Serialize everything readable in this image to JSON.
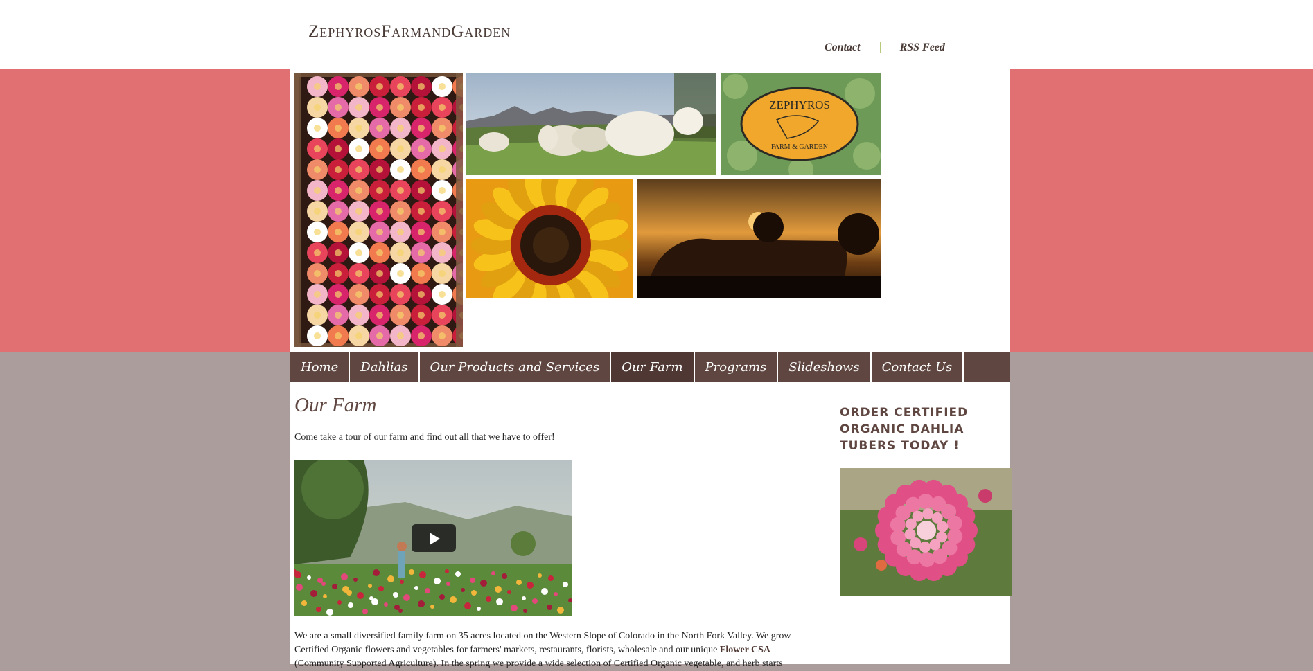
{
  "site": {
    "title": "ZephyrosFarmandGarden"
  },
  "top_links": [
    {
      "label": "Contact"
    },
    {
      "label": "RSS Feed"
    }
  ],
  "banner": {
    "logo_text": {
      "line1": "ZEPHYROS",
      "line2": "FARM & GARDEN"
    },
    "photos": [
      "dahlia-crate",
      "sheep-mountains",
      "zephyros-logo",
      "sunflower",
      "greenhouse-sunset"
    ]
  },
  "nav": {
    "items": [
      {
        "label": "Home"
      },
      {
        "label": "Dahlias"
      },
      {
        "label": "Our Products and Services"
      },
      {
        "label": "Our Farm"
      },
      {
        "label": "Programs"
      },
      {
        "label": "Slideshows"
      },
      {
        "label": "Contact Us"
      }
    ],
    "active": "Our Farm"
  },
  "main": {
    "title": "Our Farm",
    "intro": "Come take a tour of our farm and find out all that we have to offer!",
    "body_part1": "We are a small diversified family farm on 35 acres located on the Western Slope of Colorado in the North Fork Valley. We grow Certified Organic flowers and vegetables for farmers' markets, restaurants, florists, wholesale and our unique ",
    "body_link": "Flower CSA",
    "body_part2": " (Community Supported Agriculture).  In the spring we provide a wide selection of Certified Organic vegetable, and herb starts"
  },
  "sidebar": {
    "heading": "ORDER CERTIFIED ORGANIC DAHLIA TUBERS TODAY !"
  },
  "colors": {
    "header_bg": "#ffffff",
    "band": "#e07072",
    "page_bg": "#ab9d9b",
    "nav_bg": "#5f4640",
    "accent_text": "#5f4640"
  }
}
